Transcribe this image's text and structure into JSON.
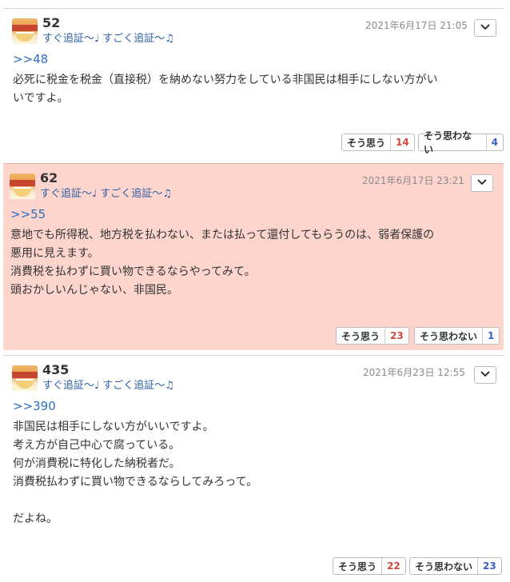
{
  "posts": [
    {
      "number": "52",
      "tag": "すぐ追証～♩ すごく追証～♫",
      "date": "2021年6月17日 21:05",
      "reply_to": ">>48",
      "body": [
        "必死に税金を税金（直接税）を納めない努力をしている非国民は相手にしない方がい",
        "いですよ。"
      ],
      "agree_label": "そう思う",
      "agree_count": "14",
      "disagree_label": "そう思わない",
      "disagree_count": "4"
    },
    {
      "number": "62",
      "tag": "すぐ追証～♩ すごく追証～♫",
      "date": "2021年6月17日 23:21",
      "reply_to": ">>55",
      "body": [
        "意地でも所得税、地方税を払わない、または払って還付してもらうのは、弱者保護の",
        "悪用に見えます。",
        "消費税を払わずに買い物できるならやってみて。",
        "頭おかしいんじゃない、非国民。"
      ],
      "agree_label": "そう思う",
      "agree_count": "23",
      "disagree_label": "そう思わない",
      "disagree_count": "1"
    },
    {
      "number": "435",
      "tag": "すぐ追証～♩ すごく追証～♫",
      "date": "2021年6月23日 12:55",
      "reply_to": ">>390",
      "body": [
        "非国民は相手にしない方がいいですよ。",
        "考え方が自己中心で腐っている。",
        "何が消費税に特化した納税者だ。",
        "消費税払わずに買い物できるならしてみろって。",
        "",
        "だよね。"
      ],
      "agree_label": "そう思う",
      "agree_count": "22",
      "disagree_label": "そう思わない",
      "disagree_count": "23"
    }
  ],
  "icons": {
    "avatar": "chicken-ramen-avatar",
    "menu": "chevron-down-icon"
  },
  "colors": {
    "highlight_bg": "#fdd5cd",
    "link": "#2b6cc4",
    "agree_count": "#d0483a",
    "disagree_count": "#3a5ec0"
  }
}
